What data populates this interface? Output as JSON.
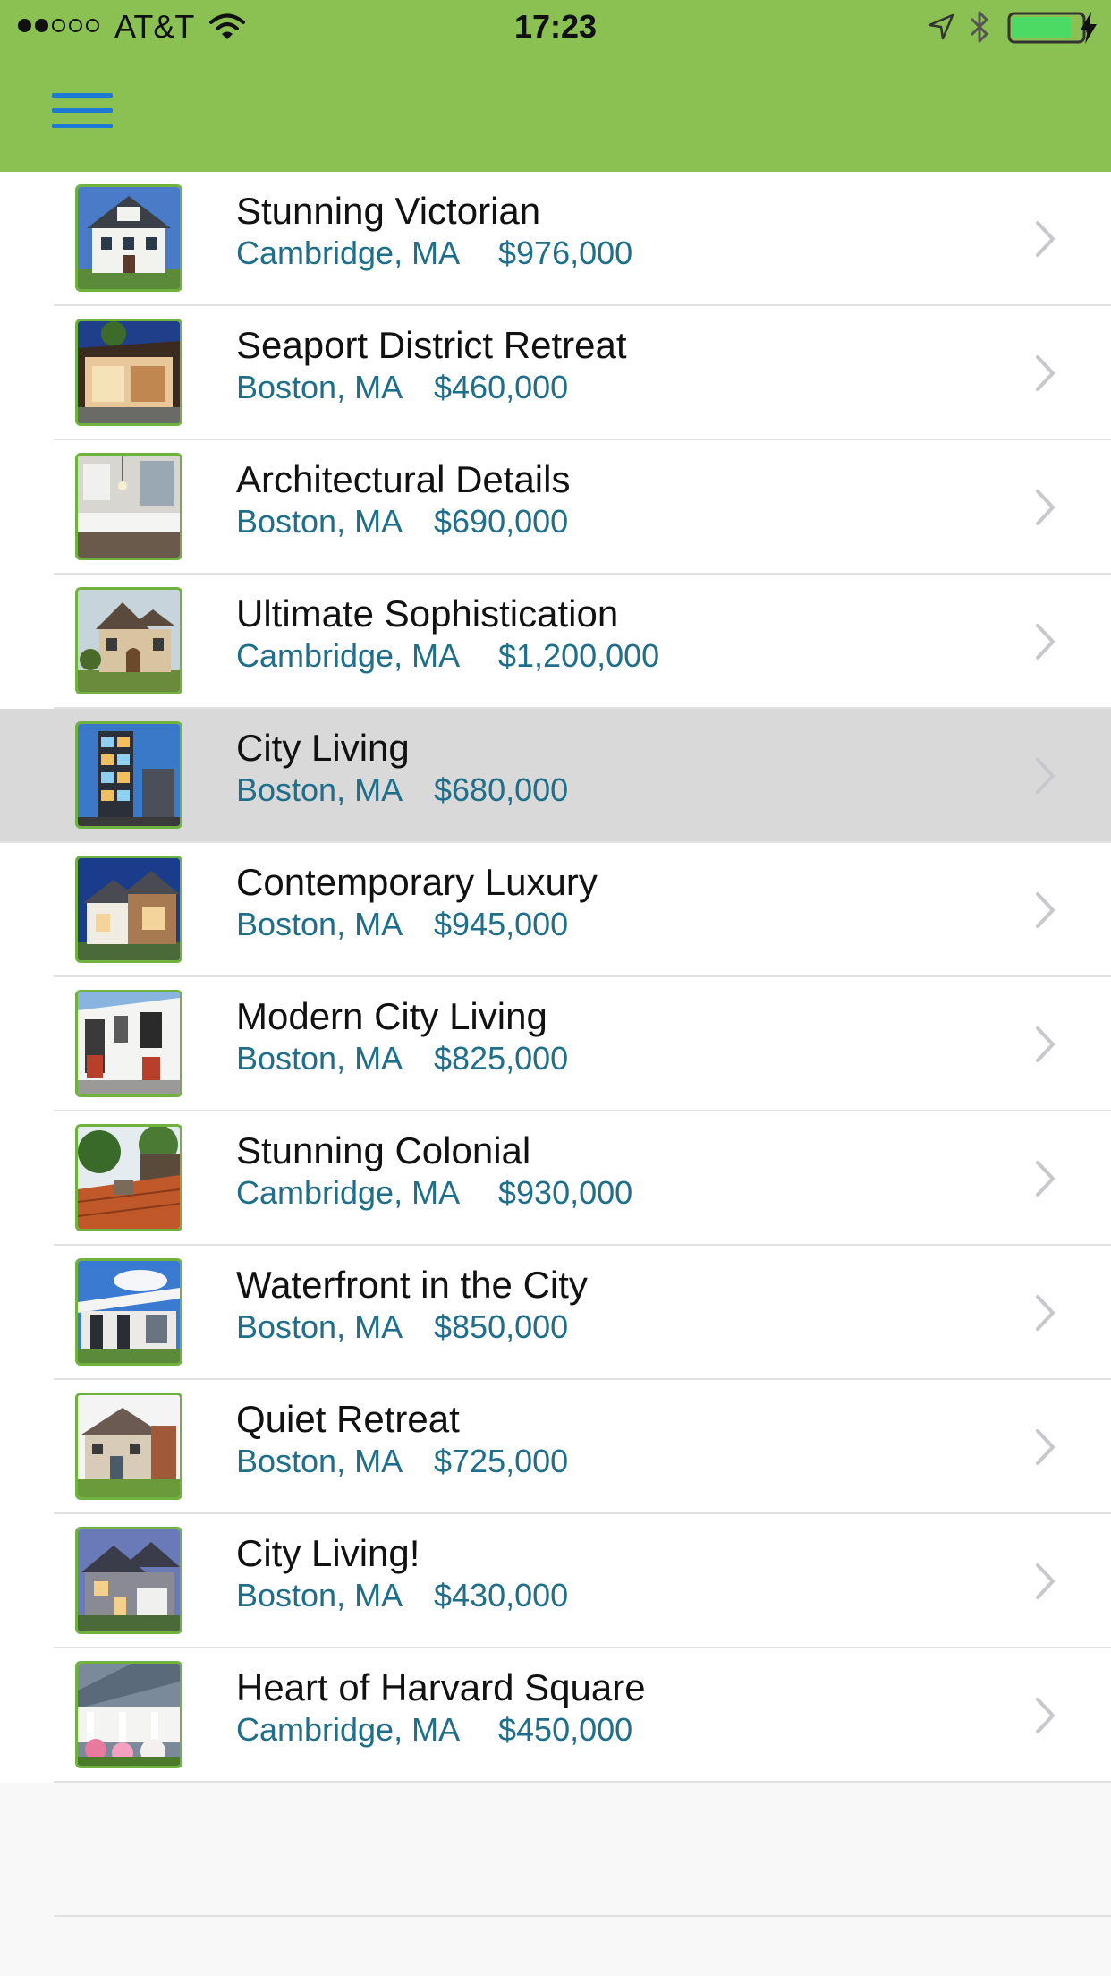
{
  "status_bar": {
    "carrier": "AT&T",
    "time": "17:23",
    "signal_bars_filled": 2,
    "signal_bars_total": 5,
    "battery_level": 0.85,
    "battery_color": "#4cd964",
    "icons": [
      "wifi-icon",
      "location-arrow-icon",
      "bluetooth-icon",
      "battery-icon",
      "charging-bolt-icon"
    ]
  },
  "header": {
    "background_color": "#8bc152",
    "menu_icon": "hamburger-menu-icon",
    "menu_icon_color": "#1e78d6"
  },
  "listings": [
    {
      "title": "Stunning Victorian",
      "location": "Cambridge, MA",
      "price": "$976,000"
    },
    {
      "title": "Seaport District Retreat",
      "location": "Boston, MA",
      "price": "$460,000"
    },
    {
      "title": "Architectural Details",
      "location": "Boston, MA",
      "price": "$690,000"
    },
    {
      "title": "Ultimate Sophistication",
      "location": "Cambridge, MA",
      "price": "$1,200,000"
    },
    {
      "title": "City Living",
      "location": "Boston, MA",
      "price": "$680,000",
      "selected": true
    },
    {
      "title": "Contemporary Luxury",
      "location": "Boston, MA",
      "price": "$945,000"
    },
    {
      "title": "Modern City Living",
      "location": "Boston, MA",
      "price": "$825,000"
    },
    {
      "title": "Stunning Colonial",
      "location": "Cambridge, MA",
      "price": "$930,000"
    },
    {
      "title": "Waterfront in the City",
      "location": "Boston, MA",
      "price": "$850,000"
    },
    {
      "title": "Quiet Retreat",
      "location": "Boston, MA",
      "price": "$725,000"
    },
    {
      "title": "City Living!",
      "location": "Boston, MA",
      "price": "$430,000"
    },
    {
      "title": "Heart of Harvard Square",
      "location": "Cambridge, MA",
      "price": "$450,000"
    }
  ],
  "colors": {
    "location_price_text": "#1f6e8a",
    "thumbnail_border": "#6fb23e",
    "selected_row_background": "#d9d9d9",
    "chevron": "#c7c7cc"
  }
}
